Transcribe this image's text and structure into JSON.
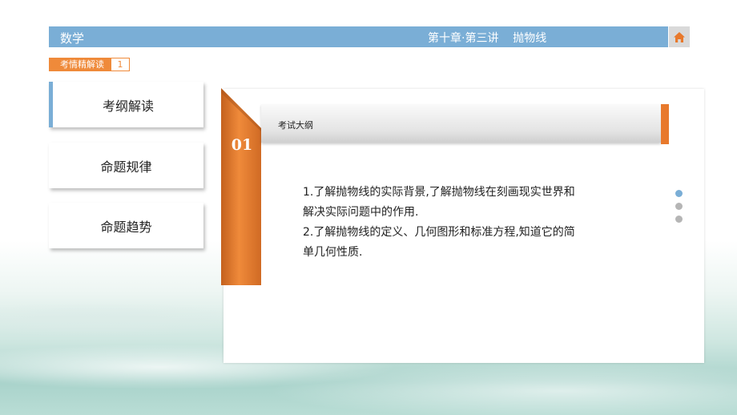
{
  "header": {
    "subject": "数学",
    "chapter": "第十章·第三讲    抛物线",
    "home_icon": "home-icon"
  },
  "section_tag": {
    "label": "考情精解读",
    "number": "1"
  },
  "sidebar": {
    "items": [
      {
        "label": "考纲解读",
        "active": true
      },
      {
        "label": "命题规律",
        "active": false
      },
      {
        "label": "命题趋势",
        "active": false
      }
    ]
  },
  "panel": {
    "ribbon_number": "01",
    "title": "考试大纲",
    "lines": [
      "1.了解抛物线的实际背景,了解抛物线在刻画现实世界和",
      "解决实际问题中的作用.",
      "2.了解抛物线的定义、几何图形和标准方程,知道它的简",
      "单几何性质."
    ]
  },
  "pager": {
    "dot_count": 3,
    "active_index": 0
  },
  "colors": {
    "header_blue": "#7aaed6",
    "accent_orange": "#ef8a3a",
    "dot_active": "#7aaed6",
    "dot_inactive": "#b5b5b5"
  }
}
